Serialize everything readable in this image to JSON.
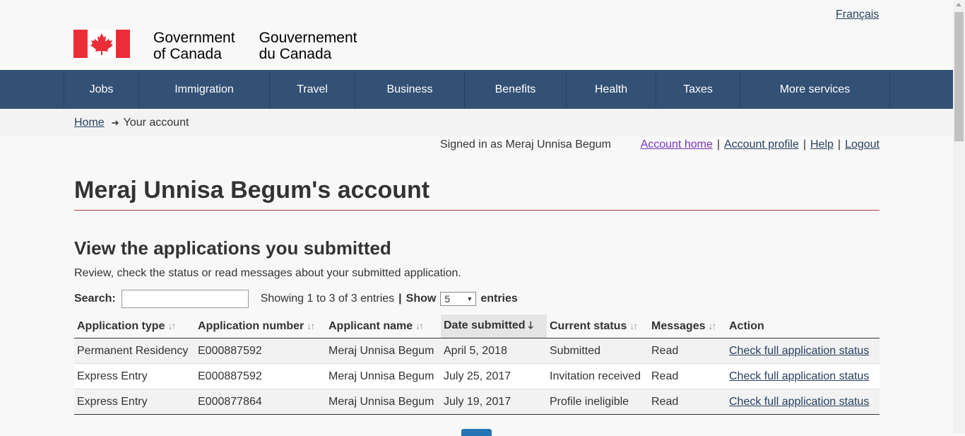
{
  "lang_toggle": "Français",
  "brand": {
    "en_line1": "Government",
    "en_line2": "of Canada",
    "fr_line1": "Gouvernement",
    "fr_line2": "du Canada",
    "flag_color": "#eb2d37"
  },
  "nav": [
    "Jobs",
    "Immigration",
    "Travel",
    "Business",
    "Benefits",
    "Health",
    "Taxes",
    "More services"
  ],
  "breadcrumb": {
    "home": "Home",
    "current": "Your account"
  },
  "userbar": {
    "signed_in": "Signed in as Meraj Unnisa Begum",
    "account_home": "Account home",
    "account_profile": "Account profile",
    "help": "Help",
    "logout": "Logout",
    "separator": "|"
  },
  "page_title": "Meraj Unnisa Begum's account",
  "section_title": "View the applications you submitted",
  "intro": "Review, check the status or read messages about your submitted application.",
  "controls": {
    "search_label": "Search:",
    "search_value": "",
    "showing": "Showing 1 to 3 of 3 entries",
    "pipe": "|",
    "show_label": "Show",
    "show_value": "5",
    "entries_label": "entries"
  },
  "table": {
    "headers": [
      "Application type",
      "Application number",
      "Applicant name",
      "Date submitted",
      "Current status",
      "Messages",
      "Action"
    ],
    "rows": [
      [
        "Permanent Residency",
        "E000887592",
        "Meraj Unnisa Begum",
        "April 5, 2018",
        "Submitted",
        "Read",
        "Check full application status"
      ],
      [
        "Express Entry",
        "E000887592",
        "Meraj Unnisa Begum",
        "July 25, 2017",
        "Invitation received",
        "Read",
        "Check full application status"
      ],
      [
        "Express Entry",
        "E000877864",
        "Meraj Unnisa Begum",
        "July 19, 2017",
        "Profile ineligible",
        "Read",
        "Check full application status"
      ]
    ]
  },
  "colors": {
    "nav_bg": "#335075",
    "link": "#284162",
    "visited_link": "#7834bc",
    "rule": "#af3c43"
  }
}
